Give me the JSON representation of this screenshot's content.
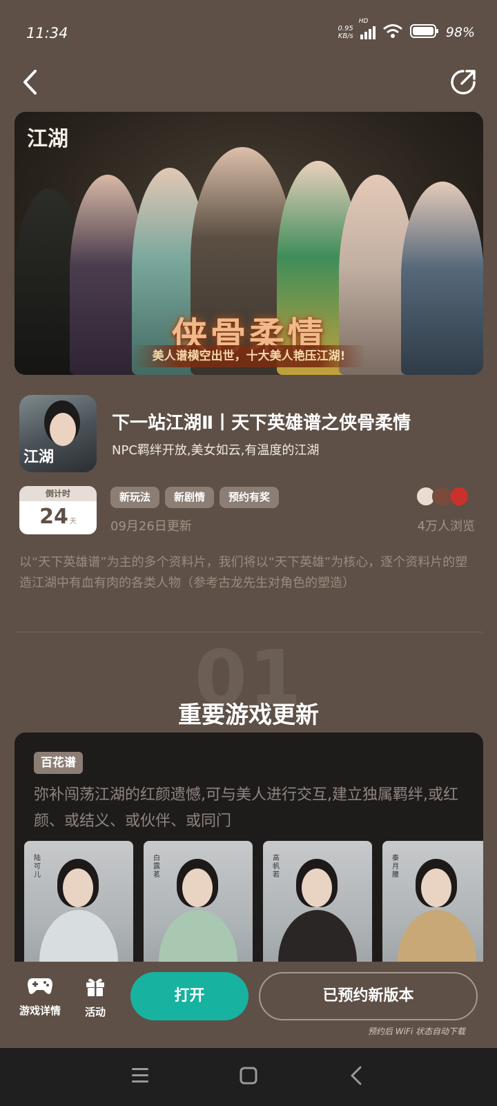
{
  "status_bar": {
    "time": "11:34",
    "net_speed_value": "0.95",
    "net_speed_unit": "KB/s",
    "network": "HD",
    "battery": "98%"
  },
  "nav": {
    "back_icon": "chevron-left-icon",
    "share_icon": "share-arrow-icon"
  },
  "banner": {
    "logo": "江湖",
    "headline": "侠骨柔情",
    "subline": "美人谱横空出世，十大美人艳压江湖!"
  },
  "app": {
    "icon_text": "江湖",
    "title": "下一站江湖Ⅱ丨天下英雄谱之侠骨柔情",
    "subtitle": "NPC羁绊开放,美女如云,有温度的江湖"
  },
  "countdown": {
    "label": "倒计时",
    "value": "24",
    "unit": "天"
  },
  "tags": [
    "新玩法",
    "新剧情",
    "预约有奖"
  ],
  "update_date": "09月26日更新",
  "views": "4万人浏览",
  "description": "以“天下英雄谱”为主的多个资料片，我们将以“天下英雄”为核心，逐个资料片的塑造江湖中有血有肉的各类人物（参考古龙先生对角色的塑造）",
  "section": {
    "number": "01",
    "title": "重要游戏更新"
  },
  "update_card": {
    "tag": "百花谱",
    "text": "弥补闯荡江湖的红颜遗憾,可与美人进行交互,建立独属羁绊,或红颜、或结义、或伙伴、或同门",
    "portraits": [
      {
        "name": "陆可儿",
        "outfit_color": "#d8dde0"
      },
      {
        "name": "白露茗",
        "outfit_color": "#a9c8b2"
      },
      {
        "name": "高帆若",
        "outfit_color": "#2b2626"
      },
      {
        "name": "秦月腰",
        "outfit_color": "#c9a877"
      }
    ]
  },
  "bottom_bar": {
    "game_detail_label": "游戏详情",
    "activity_label": "活动",
    "open_label": "打开",
    "reserved_label": "已预约新版本",
    "reserve_note": "预约后 WiFi 状态自动下载"
  },
  "colors": {
    "background": "#5e5047",
    "accent": "#17b2a0",
    "card": "#1e1c1b",
    "tag": "#8c7e75"
  }
}
